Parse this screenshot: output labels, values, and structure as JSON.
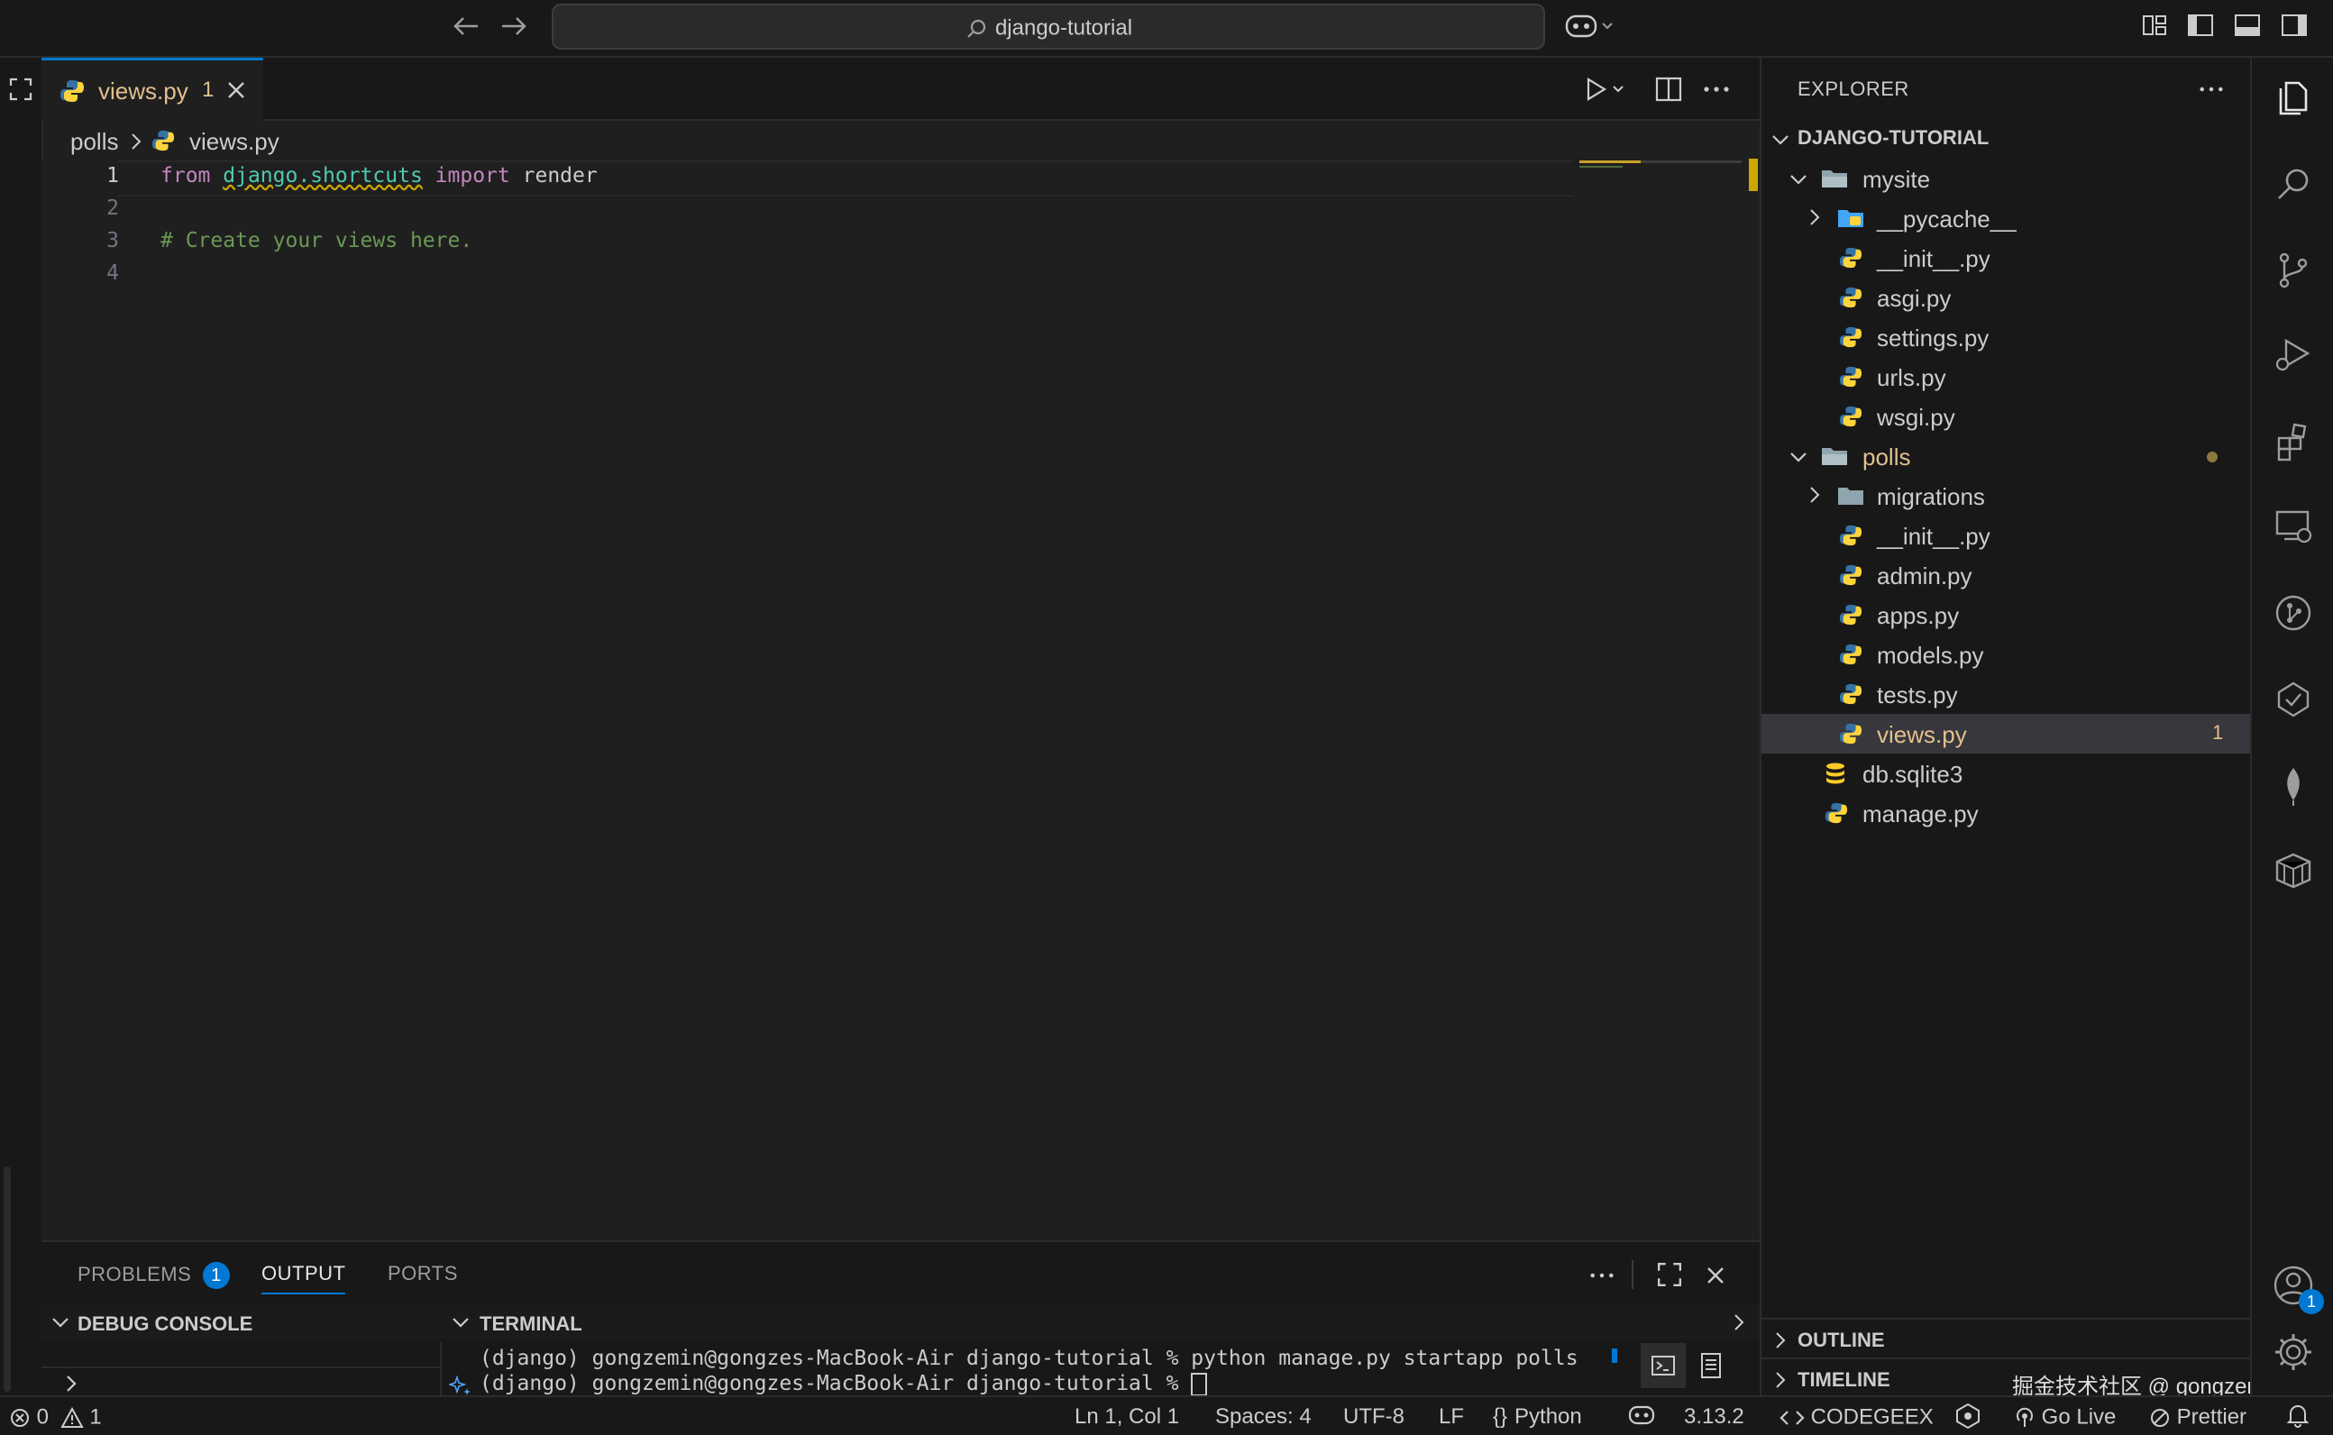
{
  "titlebar": {
    "search_text": "django-tutorial"
  },
  "tabs": [
    {
      "label": "views.py",
      "problems": "1"
    }
  ],
  "breadcrumb": {
    "folder": "polls",
    "file": "views.py"
  },
  "editor": {
    "line_numbers": [
      "1",
      "2",
      "3",
      "4"
    ],
    "line1": {
      "kw_from": "from",
      "module": "django.shortcuts",
      "kw_import": "import",
      "name": "render"
    },
    "line3": {
      "comment": "# Create your views here."
    }
  },
  "panel": {
    "tabs": {
      "problems": "PROBLEMS",
      "problems_badge": "1",
      "output": "OUTPUT",
      "ports": "PORTS"
    },
    "debug_console": "DEBUG CONSOLE",
    "terminal": "TERMINAL",
    "terminal_lines": [
      "(django) gongzemin@gongzes-MacBook-Air django-tutorial % python manage.py startapp polls",
      "(django) gongzemin@gongzes-MacBook-Air django-tutorial % "
    ]
  },
  "explorer": {
    "title": "EXPLORER",
    "root": "DJANGO-TUTORIAL",
    "mysite": {
      "label": "mysite",
      "children": [
        "__pycache__",
        "__init__.py",
        "asgi.py",
        "settings.py",
        "urls.py",
        "wsgi.py"
      ]
    },
    "polls": {
      "label": "polls",
      "children": [
        "migrations",
        "__init__.py",
        "admin.py",
        "apps.py",
        "models.py",
        "tests.py",
        "views.py"
      ],
      "views_badge": "1"
    },
    "root_files": [
      "db.sqlite3",
      "manage.py"
    ],
    "outline": "OUTLINE",
    "timeline": "TIMELINE",
    "watermark": "掘金技术社区 @ gongzemin"
  },
  "activity": {
    "accounts_badge": "1"
  },
  "status": {
    "errors": "0",
    "warnings": "1",
    "position": "Ln 1, Col 1",
    "spaces": "Spaces: 4",
    "encoding": "UTF-8",
    "eol": "LF",
    "language": "Python",
    "python_version": "3.13.2",
    "codegeex": "CODEGEEX",
    "golive": "Go Live",
    "prettier": "Prettier"
  },
  "colors": {
    "accent": "#0078d4",
    "modified": "#e2c08d",
    "folder": "#90a4ae",
    "python_blue": "#3572a5",
    "python_yellow": "#ffd43b"
  }
}
